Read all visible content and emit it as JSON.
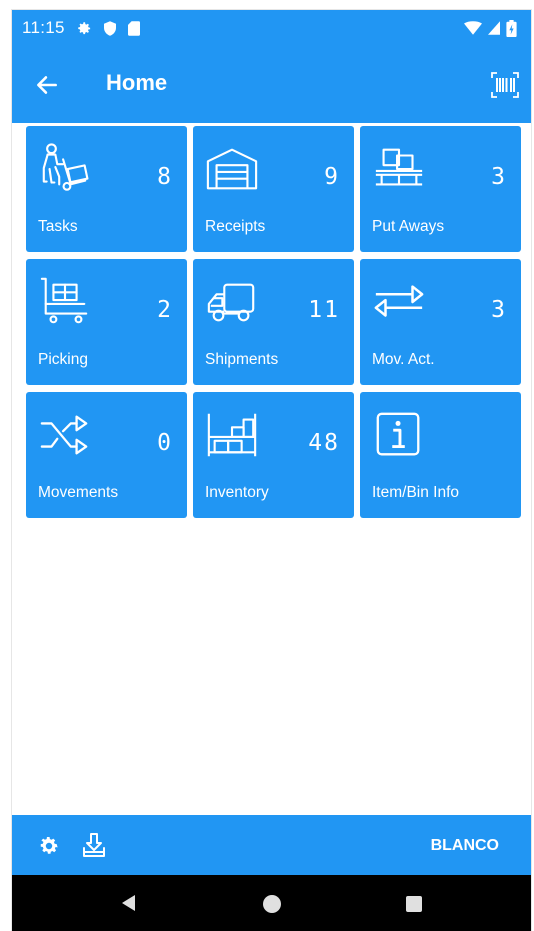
{
  "status_bar": {
    "time": "11:15"
  },
  "app_bar": {
    "title": "Home",
    "back_icon": "arrow-left-icon",
    "scan_icon": "barcode-icon"
  },
  "tiles": [
    {
      "label": "Tasks",
      "count": "8",
      "icon": "worker-hand-truck-icon"
    },
    {
      "label": "Receipts",
      "count": "9",
      "icon": "warehouse-icon"
    },
    {
      "label": "Put Aways",
      "count": "3",
      "icon": "boxes-on-pallet-icon"
    },
    {
      "label": "Picking",
      "count": "2",
      "icon": "cart-with-boxes-icon"
    },
    {
      "label": "Shipments",
      "count": "11",
      "icon": "truck-icon"
    },
    {
      "label": "Mov. Act.",
      "count": "3",
      "icon": "swap-arrows-icon"
    },
    {
      "label": "Movements",
      "count": "0",
      "icon": "shuffle-arrows-icon"
    },
    {
      "label": "Inventory",
      "count": "48",
      "icon": "shelving-icon"
    },
    {
      "label": "Item/Bin Info",
      "count": "",
      "icon": "info-icon"
    }
  ],
  "bottom_bar": {
    "user": "BLANCO",
    "settings_icon": "gear-icon",
    "download_icon": "download-tray-icon"
  },
  "colors": {
    "primary": "#2196F3",
    "nav": "#000000",
    "on_primary": "#FFFFFF"
  }
}
